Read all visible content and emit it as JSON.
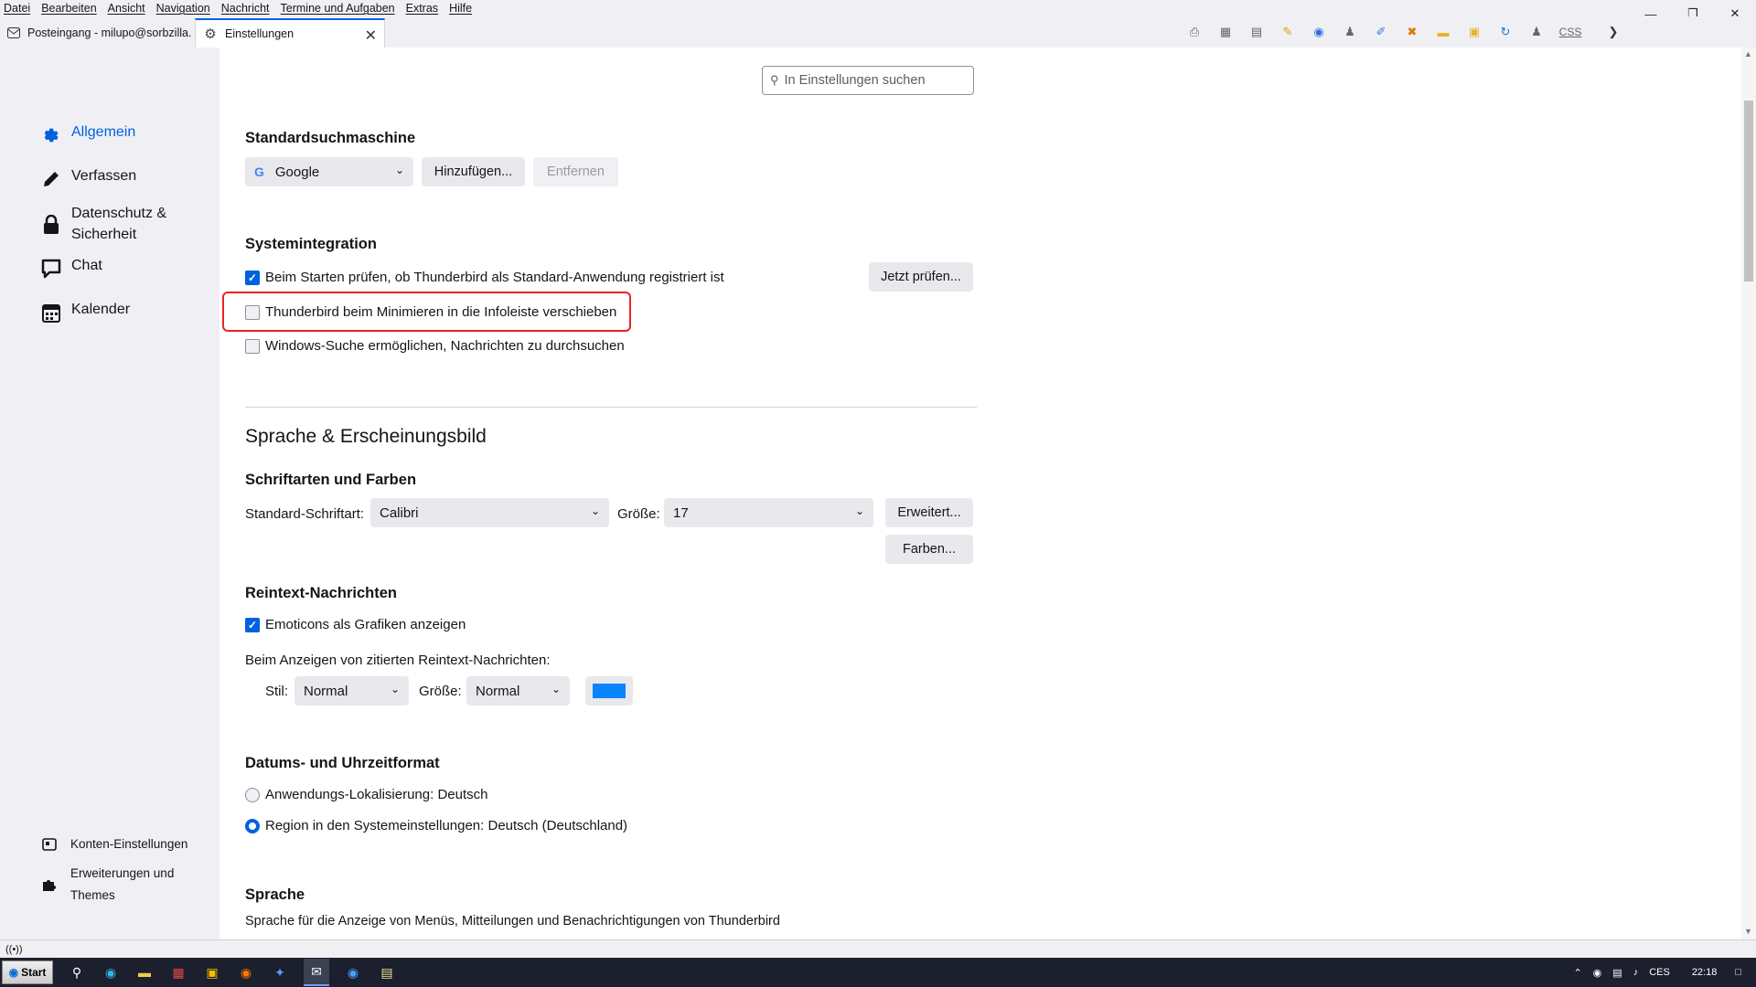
{
  "menubar": {
    "items": [
      "Datei",
      "Bearbeiten",
      "Ansicht",
      "Navigation",
      "Nachricht",
      "Termine und Aufgaben",
      "Extras",
      "Hilfe"
    ]
  },
  "tabs": {
    "inbox_label": "Posteingang - milupo@sorbzilla.de",
    "settings_label": "Einstellungen"
  },
  "sidebar": {
    "general": "Allgemein",
    "compose": "Verfassen",
    "privacy_line1": "Datenschutz &",
    "privacy_line2": "Sicherheit",
    "chat": "Chat",
    "calendar": "Kalender",
    "accounts": "Konten-Einstellungen",
    "addons_line1": "Erweiterungen und",
    "addons_line2": "Themes"
  },
  "search": {
    "placeholder": "In Einstellungen suchen"
  },
  "search_engine": {
    "heading": "Standardsuchmaschine",
    "selected": "Google",
    "add_button": "Hinzufügen...",
    "remove_button": "Entfernen"
  },
  "system_integration": {
    "heading": "Systemintegration",
    "check_default_label": "Beim Starten prüfen, ob Thunderbird als Standard-Anwendung registriert ist",
    "check_default_checked": true,
    "check_now_button": "Jetzt prüfen...",
    "minimize_tray_label": "Thunderbird beim Minimieren in die Infoleiste verschieben",
    "minimize_tray_checked": false,
    "windows_search_label": "Windows-Suche ermöglichen, Nachrichten zu durchsuchen",
    "windows_search_checked": false
  },
  "language_appearance": {
    "heading": "Sprache & Erscheinungsbild",
    "fonts_heading": "Schriftarten und Farben",
    "default_font_label": "Standard-Schriftart:",
    "default_font_value": "Calibri",
    "size_label": "Größe:",
    "size_value": "17",
    "advanced_button": "Erweitert...",
    "colors_button": "Farben..."
  },
  "plaintext": {
    "heading": "Reintext-Nachrichten",
    "emoticons_label": "Emoticons als Grafiken anzeigen",
    "emoticons_checked": true,
    "quoted_label": "Beim Anzeigen von zitierten Reintext-Nachrichten:",
    "style_label": "Stil:",
    "style_value": "Normal",
    "size_label": "Größe:",
    "size_value": "Normal",
    "quote_color": "#0a84ff"
  },
  "datetime": {
    "heading": "Datums- und Uhrzeitformat",
    "option_app": "Anwendungs-Lokalisierung: Deutsch",
    "option_region": "Region in den Systemeinstellungen: Deutsch (Deutschland)",
    "selected": "region"
  },
  "language": {
    "heading": "Sprache",
    "description": "Sprache für die Anzeige von Menüs, Mitteilungen und Benachrichtigungen von Thunderbird"
  },
  "taskbar": {
    "start_label": "Start",
    "lang": "CES",
    "time": "22:18"
  },
  "colors": {
    "accent": "#0061e0",
    "highlight_border": "#ee2222"
  }
}
